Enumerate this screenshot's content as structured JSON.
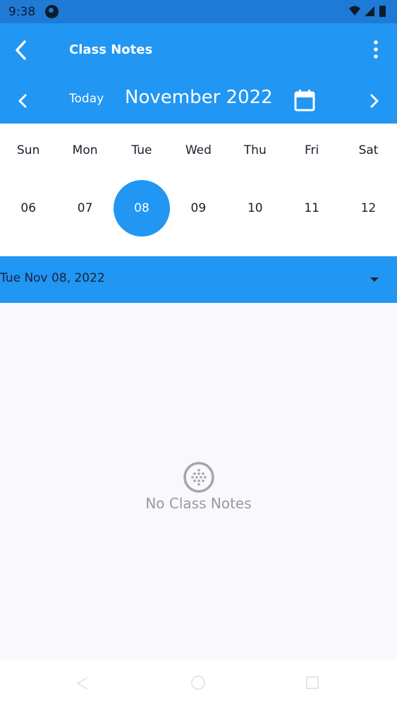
{
  "status": {
    "time": "9:38"
  },
  "appbar": {
    "title": "Class Notes"
  },
  "nav": {
    "today_label": "Today",
    "month_label": "November 2022"
  },
  "week": {
    "days_of_week": [
      "Sun",
      "Mon",
      "Tue",
      "Wed",
      "Thu",
      "Fri",
      "Sat"
    ],
    "dates": [
      "06",
      "07",
      "08",
      "09",
      "10",
      "11",
      "12"
    ],
    "selected_index": 2
  },
  "date_bar": {
    "label": "Tue Nov 08, 2022"
  },
  "empty": {
    "message": "No Class Notes"
  },
  "colors": {
    "primary": "#2196f3",
    "status_bar": "#1f7ad6",
    "background": "#f9f8fc"
  },
  "icons": {
    "back": "back-arrow-icon",
    "more": "more-vert-icon",
    "prev": "chevron-left-icon",
    "next": "chevron-right-icon",
    "calendar": "calendar-icon",
    "dropdown": "caret-down-icon",
    "empty": "empty-notes-icon"
  }
}
